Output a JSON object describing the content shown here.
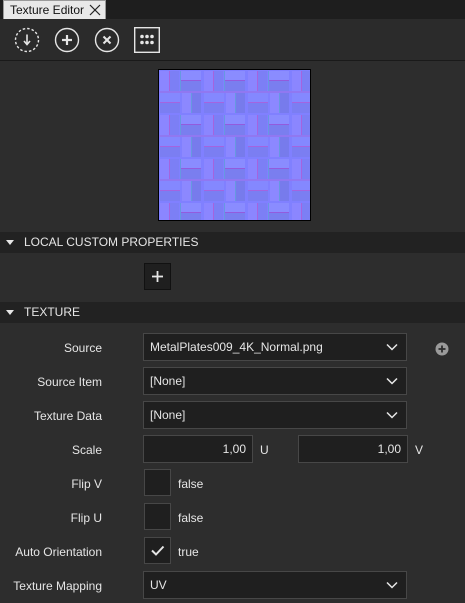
{
  "tab": {
    "title": "Texture Editor"
  },
  "toolbar": {
    "buttons": [
      {
        "icon": "import-icon"
      },
      {
        "icon": "add-circle-icon"
      },
      {
        "icon": "remove-circle-icon"
      },
      {
        "icon": "grid-dots-icon"
      }
    ]
  },
  "sections": {
    "local_custom_properties": "LOCAL CUSTOM PROPERTIES",
    "texture": "TEXTURE"
  },
  "fields": {
    "source": {
      "label": "Source",
      "value": "MetalPlates009_4K_Normal.png"
    },
    "source_item": {
      "label": "Source Item",
      "value": "[None]"
    },
    "texture_data": {
      "label": "Texture Data",
      "value": "[None]"
    },
    "scale": {
      "label": "Scale",
      "u_value": "1,00",
      "u_unit": "U",
      "v_value": "1,00",
      "v_unit": "V"
    },
    "flip_v": {
      "label": "Flip V",
      "value": "false",
      "checked": false
    },
    "flip_u": {
      "label": "Flip U",
      "value": "false",
      "checked": false
    },
    "auto_orientation": {
      "label": "Auto Orientation",
      "value": "true",
      "checked": true
    },
    "texture_mapping": {
      "label": "Texture Mapping",
      "value": "UV"
    }
  },
  "colors": {
    "normal_map_base": "#8080ff",
    "panel_bg": "#2d2d2d",
    "header_bg": "#222222"
  }
}
